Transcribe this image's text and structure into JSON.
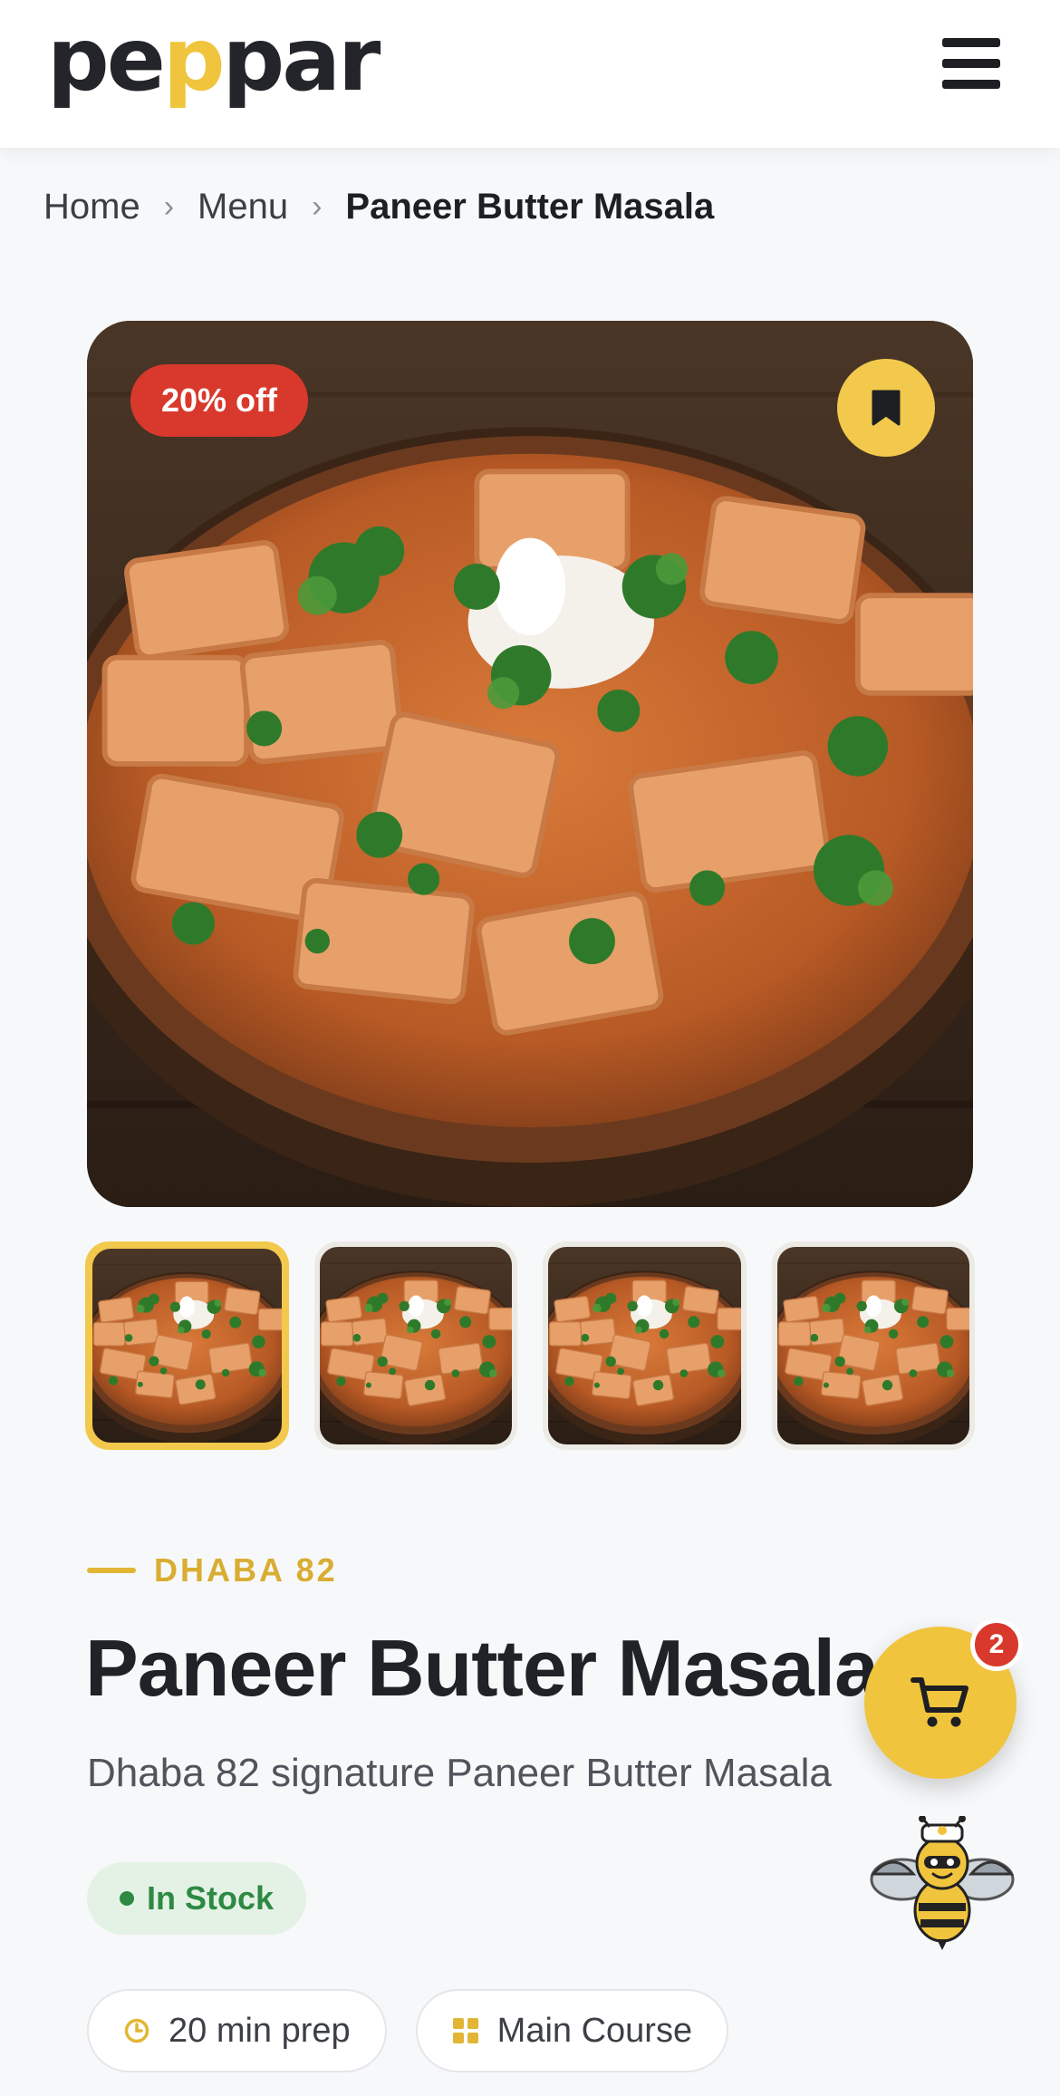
{
  "header": {
    "logo": {
      "part1": "pe",
      "accent": "p",
      "part2": "par"
    },
    "menu_icon": "hamburger-menu-icon"
  },
  "breadcrumb": {
    "items": [
      "Home",
      "Menu"
    ],
    "current": "Paneer Butter Masala",
    "separator": "›"
  },
  "product": {
    "discount_badge": "20% off",
    "bookmark_icon": "bookmark-icon",
    "restaurant": "DHABA 82",
    "title": "Paneer Butter Masala",
    "description": "Dhaba 82 signature Paneer Butter Masala",
    "stock_status": "In Stock",
    "prep_time": "20 min prep",
    "category": "Main Course",
    "thumbnail_count": 4,
    "active_thumbnail": 1
  },
  "cart": {
    "count": "2",
    "icon": "shopping-cart-icon"
  },
  "assistant": {
    "icon": "bee-chef-mascot-icon"
  },
  "colors": {
    "accent_yellow": "#f0c43c",
    "discount_red": "#d8392c",
    "stock_green": "#2e8a43",
    "stock_bg": "#e4f2e6",
    "text_dark": "#1f2226"
  }
}
